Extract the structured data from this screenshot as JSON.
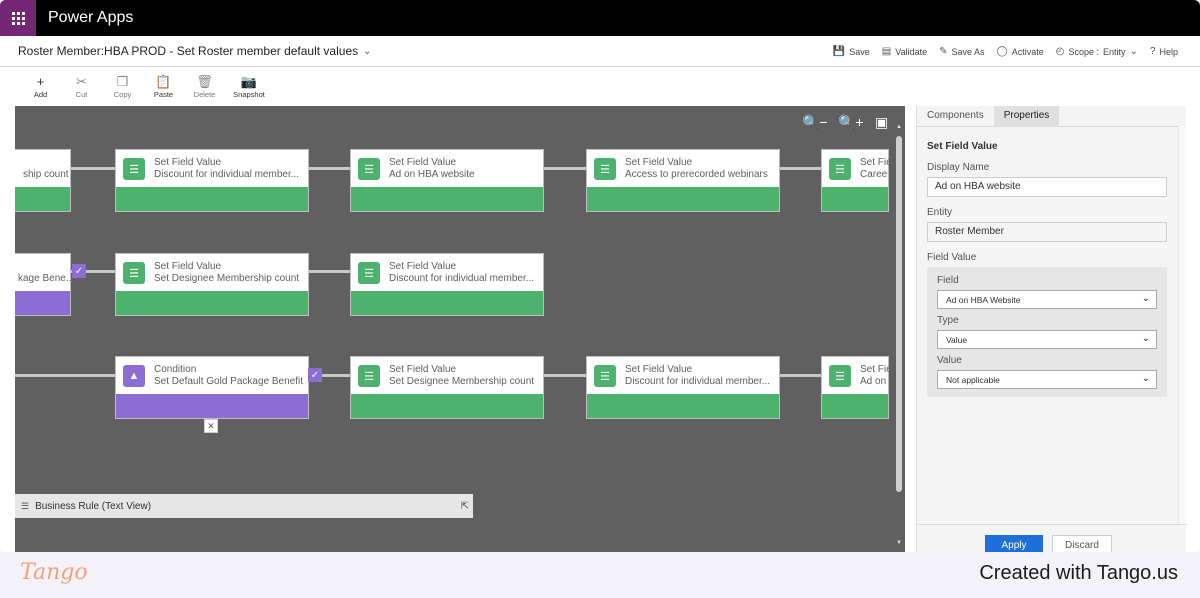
{
  "app": {
    "name": "Power Apps"
  },
  "header": {
    "title": "Roster Member:HBA PROD - Set Roster member default values",
    "actions": [
      {
        "icon": "save-icon",
        "label": "Save"
      },
      {
        "icon": "validate-icon",
        "label": "Validate"
      },
      {
        "icon": "save-as-icon",
        "label": "Save As"
      },
      {
        "icon": "activate-icon",
        "label": "Activate"
      },
      {
        "icon": "scope-icon",
        "label": "Scope :",
        "value": "Entity"
      },
      {
        "icon": "help-icon",
        "label": "Help"
      }
    ]
  },
  "ribbon": {
    "add": "Add",
    "cut": "Cut",
    "copy": "Copy",
    "paste": "Paste",
    "delete": "Delete",
    "snapshot": "Snapshot"
  },
  "canvas": {
    "nodes": {
      "r1c0": {
        "type": "",
        "name": "ship count"
      },
      "r1c1": {
        "type": "Set Field Value",
        "name": "Discount for individual member..."
      },
      "r1c2": {
        "type": "Set Field Value",
        "name": "Ad on HBA website"
      },
      "r1c3": {
        "type": "Set Field Value",
        "name": "Access to prerecorded webinars"
      },
      "r1c4": {
        "type": "Set Fie",
        "name": "Career"
      },
      "r2c0": {
        "type": "",
        "name": "kage Bene..."
      },
      "r2c1": {
        "type": "Set Field Value",
        "name": "Set Designee Membership count"
      },
      "r2c2": {
        "type": "Set Field Value",
        "name": "Discount for individual member..."
      },
      "r3c1": {
        "type": "Condition",
        "name": "Set Default Gold Package Benefit"
      },
      "r3c2": {
        "type": "Set Field Value",
        "name": "Set Designee Membership count"
      },
      "r3c3": {
        "type": "Set Field Value",
        "name": "Discount for individual member..."
      },
      "r3c4": {
        "type": "Set Fie",
        "name": "Ad on"
      }
    },
    "text_view_label": "Business Rule (Text View)"
  },
  "pane": {
    "tabs": {
      "components": "Components",
      "properties": "Properties"
    },
    "section_title": "Set Field Value",
    "display_name_label": "Display Name",
    "display_name_value": "Ad on HBA website",
    "entity_label": "Entity",
    "entity_value": "Roster Member",
    "field_value_label": "Field Value",
    "field_label": "Field",
    "field_value": "Ad on HBA Website",
    "type_label": "Type",
    "type_value": "Value",
    "value_label": "Value",
    "value_value": "Not applicable",
    "apply": "Apply",
    "discard": "Discard"
  },
  "footer": {
    "logo": "Tango",
    "credit": "Created with Tango.us"
  },
  "colors": {
    "accent_purple": "#742774",
    "set_field_green": "#4cb26e",
    "condition_purple": "#8c6dd4",
    "apply_blue": "#1e6fd9"
  }
}
